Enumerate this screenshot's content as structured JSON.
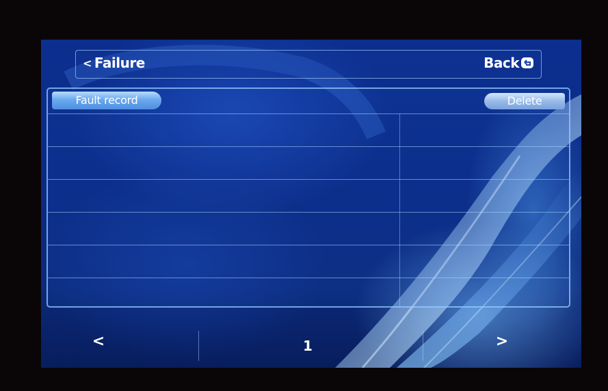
{
  "header": {
    "title_chevron": "<",
    "title": "Failure",
    "back_label": "Back"
  },
  "panel": {
    "tab_label": "Fault record",
    "delete_label": "Delete",
    "rows": [
      {
        "col1": "",
        "col2": ""
      },
      {
        "col1": "",
        "col2": ""
      },
      {
        "col1": "",
        "col2": ""
      },
      {
        "col1": "",
        "col2": ""
      },
      {
        "col1": "",
        "col2": ""
      },
      {
        "col1": "",
        "col2": ""
      }
    ]
  },
  "pagination": {
    "prev_label": "<",
    "page": "1",
    "next_label": ">"
  },
  "icons": {
    "back": "back-return-icon"
  },
  "colors": {
    "screen_bg": "#0a2a86",
    "accent": "#6aa9ef",
    "text": "#ffffff"
  }
}
